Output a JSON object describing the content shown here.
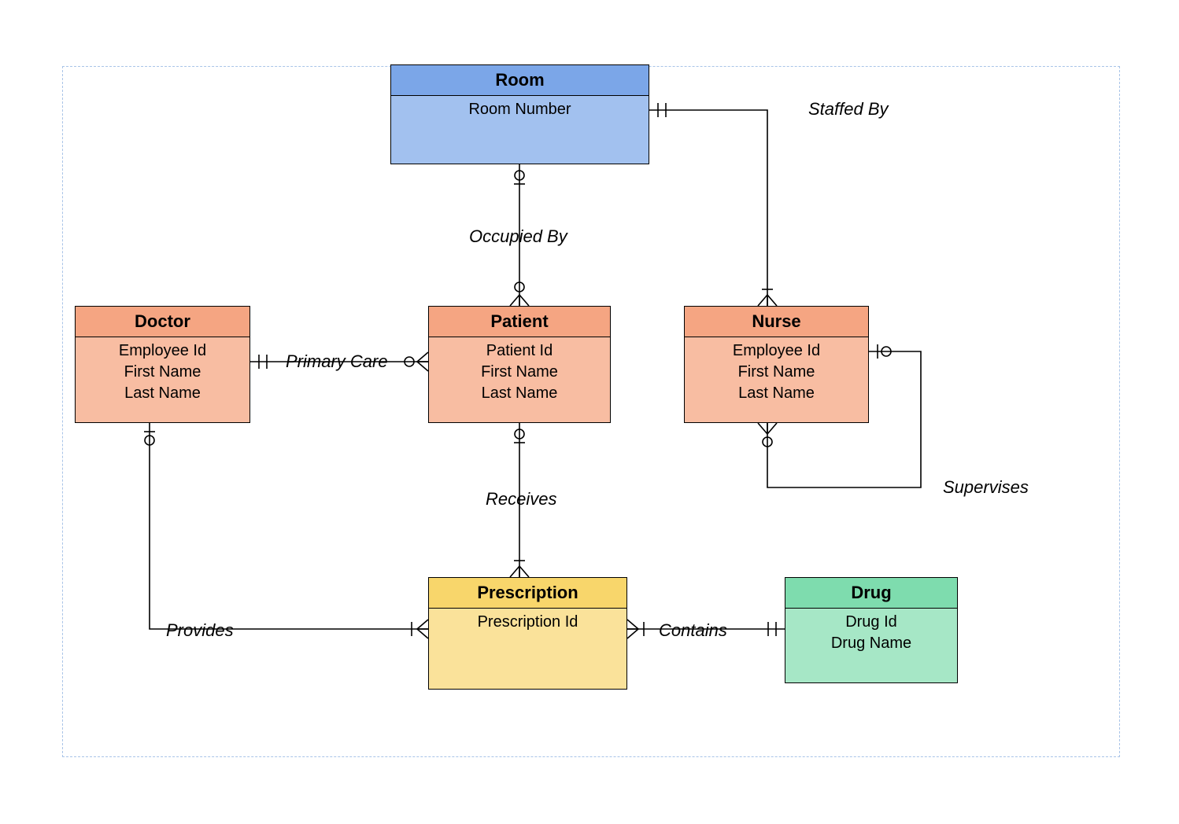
{
  "entities": {
    "room": {
      "title": "Room",
      "attrs": [
        "Room Number"
      ]
    },
    "doctor": {
      "title": "Doctor",
      "attrs": [
        "Employee Id",
        "First Name",
        "Last Name"
      ]
    },
    "patient": {
      "title": "Patient",
      "attrs": [
        "Patient Id",
        "First Name",
        "Last Name"
      ]
    },
    "nurse": {
      "title": "Nurse",
      "attrs": [
        "Employee Id",
        "First Name",
        "Last Name"
      ]
    },
    "prescription": {
      "title": "Prescription",
      "attrs": [
        "Prescription Id"
      ]
    },
    "drug": {
      "title": "Drug",
      "attrs": [
        "Drug Id",
        "Drug Name"
      ]
    }
  },
  "relationships": {
    "staffed_by": "Staffed By",
    "occupied_by": "Occupied By",
    "primary_care": "Primary Care",
    "supervises": "Supervises",
    "receives": "Receives",
    "provides": "Provides",
    "contains": "Contains"
  }
}
